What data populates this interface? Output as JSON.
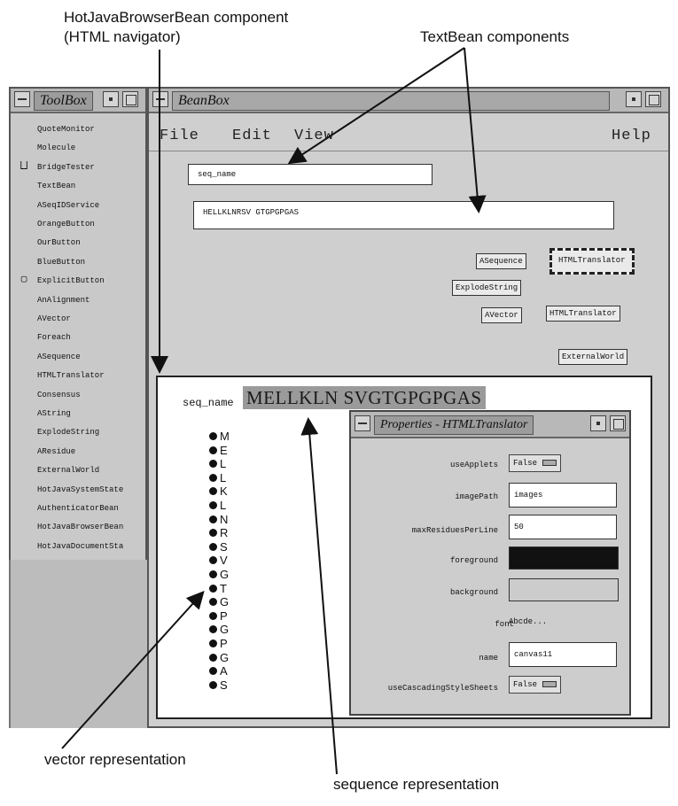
{
  "callouts": {
    "hotjava_line1": "HotJavaBrowserBean component",
    "hotjava_line2": "(HTML navigator)",
    "textbean": "TextBean components",
    "vector": "vector representation",
    "sequence": "sequence representation"
  },
  "toolbox": {
    "title": "ToolBox",
    "items": [
      {
        "label": "QuoteMonitor",
        "icon": ""
      },
      {
        "label": "Molecule",
        "icon": ""
      },
      {
        "label": "BridgeTester",
        "icon": "bridge-icon"
      },
      {
        "label": "TextBean",
        "icon": ""
      },
      {
        "label": "ASeqIDService",
        "icon": ""
      },
      {
        "label": "OrangeButton",
        "icon": ""
      },
      {
        "label": "OurButton",
        "icon": ""
      },
      {
        "label": "BlueButton",
        "icon": ""
      },
      {
        "label": "ExplicitButton",
        "icon": "button-icon"
      },
      {
        "label": "AnAlignment",
        "icon": ""
      },
      {
        "label": "AVector",
        "icon": ""
      },
      {
        "label": "Foreach",
        "icon": ""
      },
      {
        "label": "ASequence",
        "icon": ""
      },
      {
        "label": "HTMLTranslator",
        "icon": ""
      },
      {
        "label": "Consensus",
        "icon": ""
      },
      {
        "label": "AString",
        "icon": ""
      },
      {
        "label": "ExplodeString",
        "icon": ""
      },
      {
        "label": "AResidue",
        "icon": ""
      },
      {
        "label": "ExternalWorld",
        "icon": ""
      },
      {
        "label": "HotJavaSystemState",
        "icon": ""
      },
      {
        "label": "AuthenticatorBean",
        "icon": ""
      },
      {
        "label": "HotJavaBrowserBean",
        "icon": ""
      },
      {
        "label": "HotJavaDocumentSta",
        "icon": ""
      }
    ]
  },
  "beanbox": {
    "title": "BeanBox",
    "menu": {
      "file": "File",
      "edit": "Edit",
      "view": "View",
      "help": "Help"
    },
    "seq_name_field": "seq_name",
    "sequence_field": "HELLKLNRSV GTGPGPGAS",
    "beans": {
      "asequence": "ASequence",
      "htmltranslator_selected": "HTMLTranslator",
      "explodestring": "ExplodeString",
      "avector": "AVector",
      "htmltranslator": "HTMLTranslator",
      "externalworld": "ExternalWorld"
    }
  },
  "html_view": {
    "seq_label": "seq_name",
    "sequence_rep": "MELLKLN SVGTGPGPGAS",
    "vector": [
      "M",
      "E",
      "L",
      "L",
      "K",
      "L",
      "N",
      "R",
      "S",
      "V",
      "G",
      "T",
      "G",
      "P",
      "G",
      "P",
      "G",
      "A",
      "S"
    ]
  },
  "properties": {
    "title": "Properties - HTMLTranslator",
    "useApplets": {
      "label": "useApplets",
      "value": "False"
    },
    "imagePath": {
      "label": "imagePath",
      "value": "images"
    },
    "maxResiduesPerLine": {
      "label": "maxResiduesPerLine",
      "value": "50"
    },
    "foreground": {
      "label": "foreground",
      "color": "#111111"
    },
    "background": {
      "label": "background",
      "color": "#cccccc"
    },
    "font": {
      "label": "font",
      "value": "Abcde..."
    },
    "name": {
      "label": "name",
      "value": "canvas11"
    },
    "useCascadingStyleSheets": {
      "label": "useCascadingStyleSheets",
      "value": "False"
    }
  }
}
